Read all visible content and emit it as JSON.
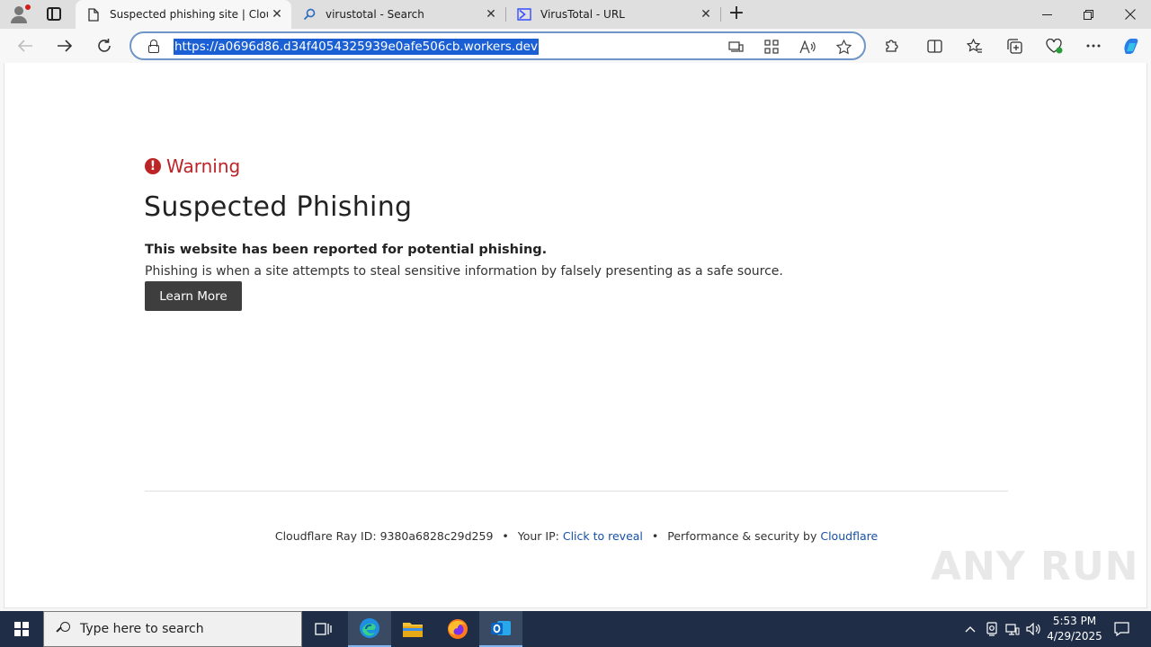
{
  "browser": {
    "tabs": [
      {
        "title": "Suspected phishing site | Cloudfl",
        "favicon": "page-icon",
        "active": true
      },
      {
        "title": "virustotal - Search",
        "favicon": "search-icon",
        "active": false
      },
      {
        "title": "VirusTotal - URL",
        "favicon": "virustotal-icon",
        "active": false
      }
    ],
    "close_glyph": "✕",
    "new_tab_glyph": "+",
    "url": "https://a0696d86.d34f4054325939e0afe506cb.workers.dev",
    "colors": {
      "url_highlight": "#1a5fd4",
      "omnibox_border": "#6e96c8",
      "tabstrip": "#dfdfdf"
    }
  },
  "page": {
    "warning_label": "Warning",
    "warning_glyph": "!",
    "heading": "Suspected Phishing",
    "lead": "This website has been reported for potential phishing.",
    "description": "Phishing is when a site attempts to steal sensitive information by falsely presenting as a safe source.",
    "learn_more": "Learn More",
    "colors": {
      "warning": "#bd2426",
      "button": "#3e3e3e",
      "link": "#1650a6"
    }
  },
  "footer": {
    "ray_label": "Cloudflare Ray ID:",
    "ray_id": "9380a6828c29d259",
    "bullet": "•",
    "ip_label": "Your IP:",
    "ip_link": "Click to reveal",
    "perf_label": "Performance & security by",
    "perf_link": "Cloudflare"
  },
  "watermark": "ANY RUN",
  "taskbar": {
    "search_placeholder": "Type here to search",
    "time": "5:53 PM",
    "date": "4/29/2025",
    "apps": [
      "task-view-icon",
      "edge-icon",
      "file-explorer-icon",
      "firefox-icon",
      "outlook-icon"
    ]
  }
}
